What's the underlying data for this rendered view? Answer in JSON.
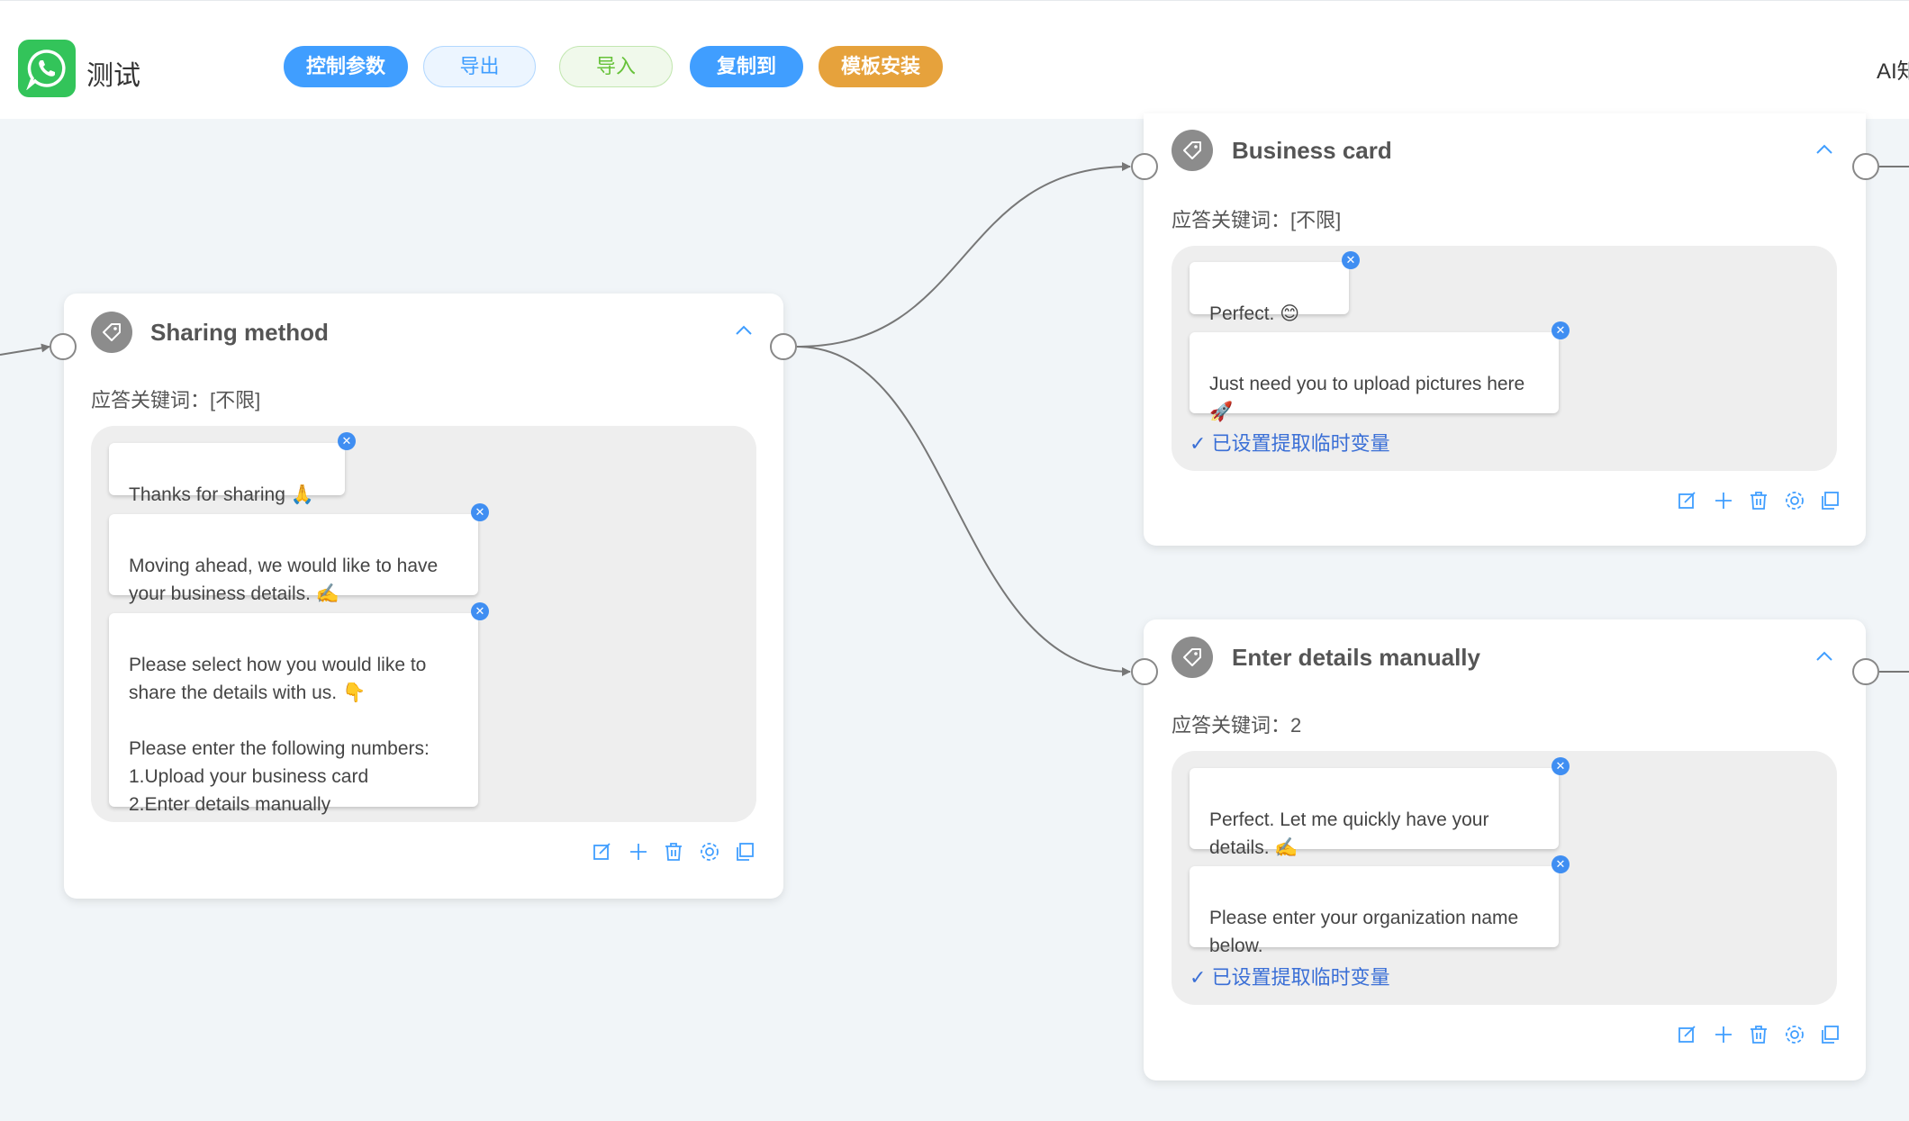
{
  "header": {
    "app_title": "测试",
    "buttons": {
      "control_params": "控制参数",
      "export": "导出",
      "import": "导入",
      "copy_to": "复制到",
      "template_install": "模板安装"
    },
    "ai_link": "AI知"
  },
  "colors": {
    "primary": "#409eff",
    "success": "#67c23a",
    "warning": "#e6a23c",
    "whatsapp": "#33c45a",
    "badge": "#3f8ef2",
    "var_link": "#3a6fd6"
  },
  "icons": [
    "whatsapp-logo-icon",
    "tag-icon",
    "chevron-up-icon",
    "close-icon",
    "check-icon",
    "edit-icon",
    "plus-icon",
    "trash-icon",
    "gear-icon",
    "copy-icon"
  ],
  "nodes": {
    "sharing": {
      "title": "Sharing method",
      "keyword": "应答关键词：[不限]",
      "messages": [
        "Thanks for sharing 🙏",
        "Moving ahead, we would like to have your business details. ✍️",
        "Please select how you would like to share the details with us. 👇\n\nPlease enter the following numbers:\n1.Upload your business card\n2.Enter details manually"
      ]
    },
    "business_card": {
      "title": "Business card",
      "keyword": "应答关键词：[不限]",
      "messages": [
        "Perfect. 😊",
        "Just need you to upload pictures here 🚀"
      ],
      "var_set": "已设置提取临时变量"
    },
    "manual": {
      "title": "Enter details manually",
      "keyword": "应答关键词：2",
      "messages": [
        "Perfect. Let me quickly have your details. ✍️",
        "Please enter your organization name below."
      ],
      "var_set": "已设置提取临时变量"
    }
  }
}
